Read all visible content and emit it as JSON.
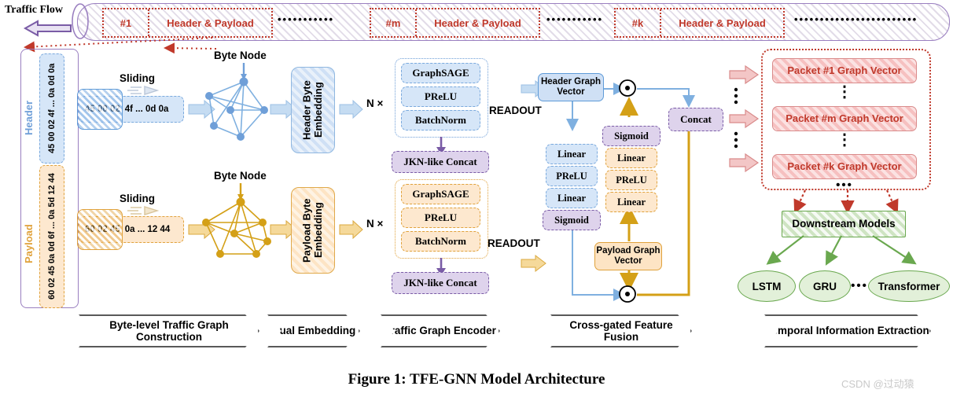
{
  "figure": {
    "caption": "Figure 1: TFE-GNN Model Architecture",
    "watermark": "CSDN @过动猿"
  },
  "traffic_flow": {
    "label": "Traffic Flow",
    "arrow_icon": "left-arrow-icon",
    "packets": [
      {
        "id": "#1",
        "content": "Header & Payload"
      },
      {
        "id": "#m",
        "content": "Header & Payload"
      },
      {
        "id": "#k",
        "content": "Header & Payload"
      }
    ],
    "ellipsis": "•••••••••••",
    "tail_ellipsis": "••••••••••••••••••••••••"
  },
  "packet_detail": {
    "header_label": "Header",
    "payload_label": "Payload",
    "header_bytes": "45 00 02 4f ... 0a 0d 0a",
    "payload_bytes": "60 02 45 0a 0d 6f ... 0a 5d 12 44"
  },
  "sliding": {
    "title": "Sliding",
    "header_window_bytes": "45 00 02",
    "header_rest_bytes": "4f ... 0d 0a",
    "payload_window_bytes": "60 02 45",
    "payload_rest_bytes": "0a ... 12 44"
  },
  "graph": {
    "byte_node_label": "Byte Node"
  },
  "embedding": {
    "header": "Header Byte Embedding",
    "payload": "Payload Byte Embedding"
  },
  "encoder": {
    "repeat_label": "N ×",
    "readout_label": "READOUT",
    "header_layers": [
      "GraphSAGE",
      "PReLU",
      "BatchNorm"
    ],
    "payload_layers": [
      "GraphSAGE",
      "PReLU",
      "BatchNorm"
    ],
    "jkn_header": "JKN-like Concat",
    "jkn_payload": "JKN-like Concat"
  },
  "fusion": {
    "header_vector": "Header Graph Vector",
    "payload_vector": "Payload Graph Vector",
    "header_gate": [
      "Linear",
      "PReLU",
      "Linear",
      "Sigmoid"
    ],
    "payload_gate": [
      "Sigmoid",
      "Linear",
      "PReLU",
      "Linear"
    ],
    "concat": "Concat",
    "product_icon": "element-wise-product-icon"
  },
  "temporal": {
    "packet_vectors": [
      "Packet #1 Graph Vector",
      "Packet #m Graph Vector",
      "Packet #k Graph Vector"
    ],
    "vertical_ellipsis": "⋮",
    "group_ellipsis": "•••",
    "downstream": "Downstream Models",
    "models": [
      "LSTM",
      "GRU",
      "Transformer"
    ],
    "models_ellipsis": "•••"
  },
  "stages": [
    "Byte-level Traffic Graph Construction",
    "Dual Embedding",
    "Traffic Graph Encoder",
    "Cross-gated Feature Fusion",
    "Temporal Information Extraction"
  ],
  "colors": {
    "header_blue": "#6f9fd8",
    "payload_orange": "#e0a23c",
    "purple": "#7a5ca6",
    "red": "#c0392b",
    "green": "#6aa84f"
  }
}
